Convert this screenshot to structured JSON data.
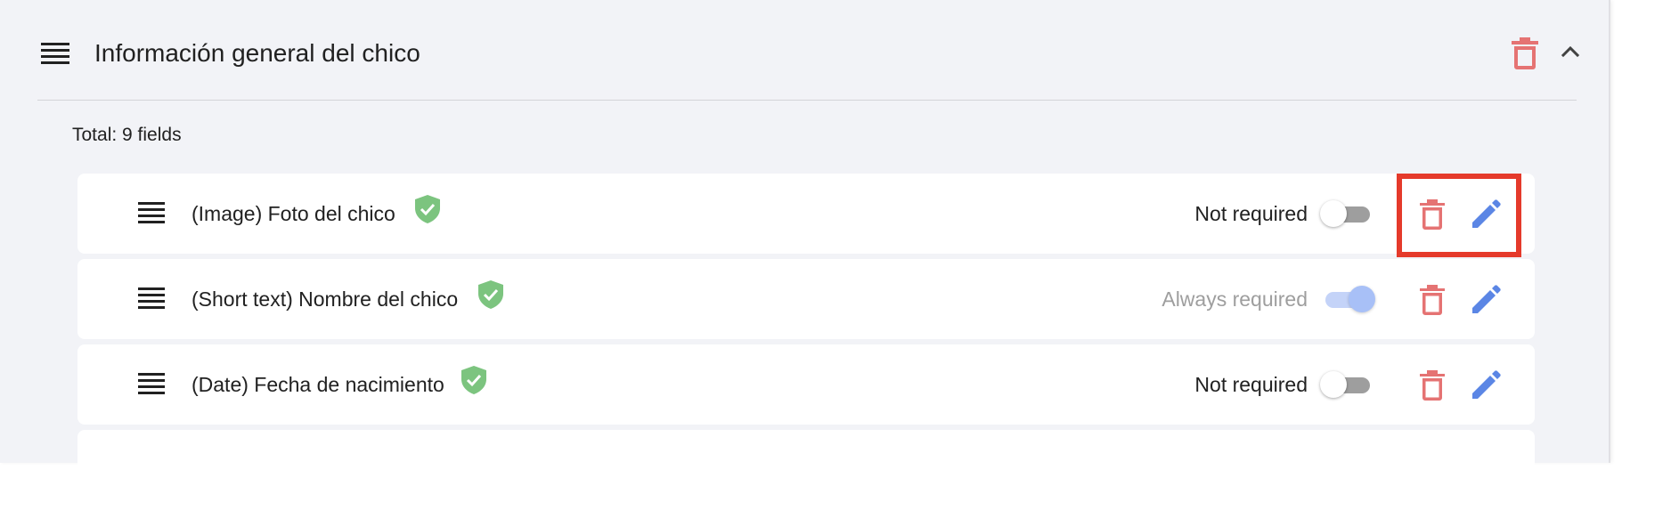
{
  "section": {
    "title": "Información general del chico",
    "total": "Total: 9 fields"
  },
  "colors": {
    "delete": "#e57373",
    "edit": "#5b86e5",
    "shield": "#7cc47f",
    "highlight": "#e53a2b",
    "panel_bg": "#f2f3f7"
  },
  "icons": {
    "drag_handle": "drag-handle-icon",
    "delete": "trash-icon",
    "collapse": "chevron-up-icon",
    "edit": "pencil-icon",
    "verified": "shield-check-icon"
  },
  "fields": [
    {
      "label": "(Image) Foto del chico",
      "requirement": "Not required",
      "toggle_on": false,
      "toggle_disabled": false
    },
    {
      "label": "(Short text) Nombre del chico",
      "requirement": "Always required",
      "toggle_on": true,
      "toggle_disabled": true
    },
    {
      "label": "(Date) Fecha de nacimiento",
      "requirement": "Not required",
      "toggle_on": false,
      "toggle_disabled": false
    }
  ]
}
